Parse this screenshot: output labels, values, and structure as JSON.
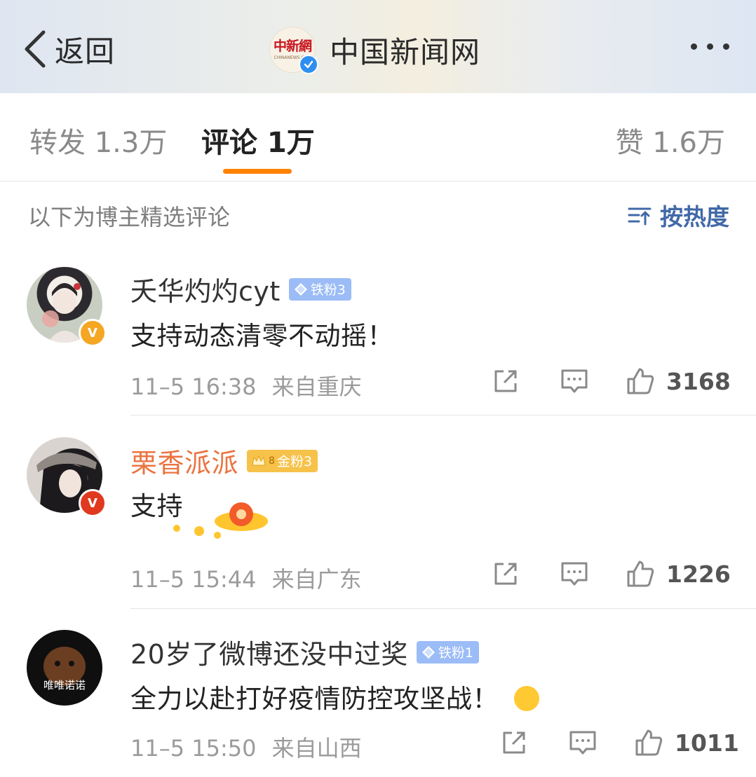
{
  "header": {
    "back_label": "返回",
    "logo_cn": "中新網",
    "logo_en": "CHINANEWS.COM",
    "account_name": "中国新闻网"
  },
  "tabs": {
    "repost": "转发 1.3万",
    "comment": "评论 1万",
    "like": "赞 1.6万"
  },
  "selection": {
    "text": "以下为博主精选评论",
    "sort_label": "按热度"
  },
  "comments": [
    {
      "username": "夭华灼灼cyt",
      "badge": "铁粉3",
      "text": "支持动态清零不动摇！",
      "time": "11–5 16:38",
      "location": "来自重庆",
      "likes": "3168"
    },
    {
      "username": "栗香派派",
      "badge": "金粉3",
      "crown_level": "8",
      "text": "支持",
      "time": "11–5 15:44",
      "location": "来自广东",
      "likes": "1226"
    },
    {
      "username": "20岁了微博还没中过奖",
      "badge": "铁粉1",
      "avatar_text": "唯唯诺诺",
      "text": "全力以赴打好疫情防控攻坚战！",
      "time": "11–5 15:50",
      "location": "来自山西",
      "likes": "1011"
    }
  ],
  "colors": {
    "accent_orange": "#ff8200",
    "link_blue": "#4169a8",
    "verify_gold": "#f5a623",
    "verify_red": "#e0391f",
    "iron_fan": "#9bbcf6",
    "gold_fan": "#f7c24a"
  },
  "icons": [
    "chevron-left-icon",
    "verified-icon",
    "more-icon",
    "sort-icon",
    "share-icon",
    "comment-icon",
    "thumbs-up-icon",
    "diamond-icon",
    "crown-icon"
  ]
}
